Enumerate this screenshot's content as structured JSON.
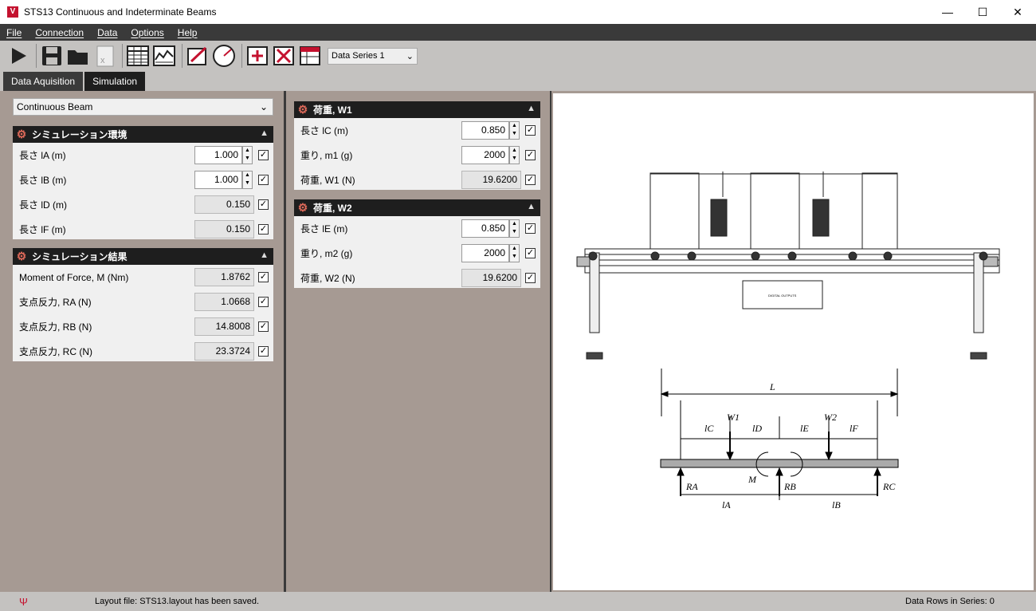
{
  "window": {
    "title": "STS13 Continuous and Indeterminate Beams",
    "icon": "V"
  },
  "menu": [
    "File",
    "Connection",
    "Data",
    "Options",
    "Help"
  ],
  "toolbar": {
    "series_value": "Data Series 1",
    "icons": [
      "play-icon",
      "save-icon",
      "open-folder-icon",
      "export-excel-icon",
      "table-icon",
      "chart-icon",
      "edit-chart-icon",
      "gauge-icon",
      "add-series-icon",
      "delete-series-icon",
      "series-table-icon"
    ]
  },
  "tabs": [
    "Data Aquisition",
    "Simulation"
  ],
  "beam_type": "Continuous Beam",
  "env": {
    "title": "シミュレーション環境",
    "rows": [
      {
        "label": "長さ lA (m)",
        "value": "1.000",
        "editable": true
      },
      {
        "label": "長さ lB (m)",
        "value": "1.000",
        "editable": true
      },
      {
        "label": "長さ lD (m)",
        "value": "0.150",
        "editable": false
      },
      {
        "label": "長さ lF (m)",
        "value": "0.150",
        "editable": false
      }
    ]
  },
  "results": {
    "title": "シミュレーション結果",
    "rows": [
      {
        "label": "Moment of Force, M (Nm)",
        "value": "1.8762"
      },
      {
        "label": "支点反力, RA (N)",
        "value": "1.0668"
      },
      {
        "label": "支点反力, RB (N)",
        "value": "14.8008"
      },
      {
        "label": "支点反力, RC (N)",
        "value": "23.3724"
      }
    ]
  },
  "w1": {
    "title": "荷重, W1",
    "rows": [
      {
        "label": "長さ lC (m)",
        "value": "0.850",
        "editable": true
      },
      {
        "label": "重り, m1 (g)",
        "value": "2000",
        "editable": true
      },
      {
        "label": "荷重, W1 (N)",
        "value": "19.6200",
        "editable": false
      }
    ]
  },
  "w2": {
    "title": "荷重, W2",
    "rows": [
      {
        "label": "長さ lE (m)",
        "value": "0.850",
        "editable": true
      },
      {
        "label": "重り, m2 (g)",
        "value": "2000",
        "editable": true
      },
      {
        "label": "荷重, W2 (N)",
        "value": "19.6200",
        "editable": false
      }
    ]
  },
  "diagram": {
    "L": "L",
    "W1": "W1",
    "W2": "W2",
    "lC": "lC",
    "lD": "lD",
    "lE": "lE",
    "lF": "lF",
    "M": "M",
    "RA": "RA",
    "RB": "RB",
    "RC": "RC",
    "lA": "lA",
    "lB": "lB",
    "panel_label": "DIGITAL OUTPUTS"
  },
  "status": {
    "message": "Layout file: STS13.layout has been saved.",
    "rows": "Data Rows in Series: 0"
  }
}
